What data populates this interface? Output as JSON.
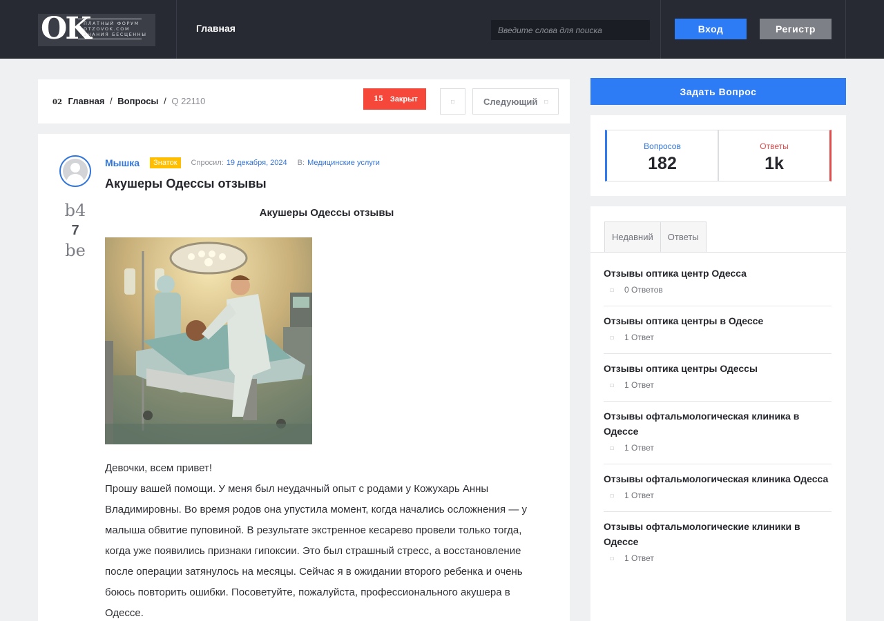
{
  "header": {
    "logo": {
      "letters": "OK",
      "line1": "ПЛАТНЫЙ ФОРУМ",
      "line2": "OTZOVOK.COM",
      "line3": "ЗНАНИЯ БЕСЦЕННЫ"
    },
    "nav_home": "Главная",
    "search_placeholder": "Введите слова для поиска",
    "login_label": "Вход",
    "register_label": "Регистр"
  },
  "breadcrumb": {
    "icon_glyph": "02",
    "items": [
      "Главная",
      "Вопросы"
    ],
    "current": "Q 22110",
    "closed_count": "15",
    "closed_label": "Закрыт",
    "next_label": "Следующий"
  },
  "question": {
    "author": "Мышка",
    "badge": "Знаток",
    "asked_label": "Спросил:",
    "date": "19 декабря, 2024",
    "in_label": "В:",
    "category": "Медицинские услуги",
    "title": "Акушеры Одессы отзывы",
    "subheading": "Акушеры Одессы отзывы",
    "vote_up_glyph": "b4",
    "votes": "7",
    "vote_down_glyph": "be",
    "greeting": "Девочки, всем привет!",
    "body": "Прошу вашей помощи. У меня был неудачный опыт с родами у Кожухарь Анны Владимировны. Во время родов она упустила момент, когда начались осложнения — у малыша обвитие пуповиной. В результате экстренное кесарево провели только тогда, когда уже появились признаки гипоксии. Это был страшный стресс, а восстановление после операции затянулось на месяцы. Сейчас я в ожидании второго ребенка и очень боюсь повторить ошибки. Посоветуйте, пожалуйста, профессионального акушера в Одессе."
  },
  "sidebar": {
    "ask_label": "Задать Вопрос",
    "stats": {
      "questions_label": "Вопросов",
      "questions_value": "182",
      "answers_label": "Ответы",
      "answers_value": "1k"
    },
    "tabs": [
      "Недавний",
      "Ответы"
    ],
    "items": [
      {
        "title": "Отзывы оптика центр Одесса",
        "count": "0 Ответов"
      },
      {
        "title": "Отзывы оптика центры в Одессе",
        "count": "1 Ответ"
      },
      {
        "title": "Отзывы оптика центры Одессы",
        "count": "1 Ответ"
      },
      {
        "title": "Отзывы офтальмологическая клиника в Одессе",
        "count": "1 Ответ"
      },
      {
        "title": "Отзывы офтальмологическая клиника Одесса",
        "count": "1 Ответ"
      },
      {
        "title": "Отзывы офтальмологические клиники в Одессе",
        "count": "1 Ответ"
      }
    ]
  },
  "colors": {
    "accent": "#2e7bf6",
    "header_bg": "#272a33",
    "closed": "#f5483b",
    "badge": "#ffbf00",
    "answers": "#e04b4b"
  }
}
